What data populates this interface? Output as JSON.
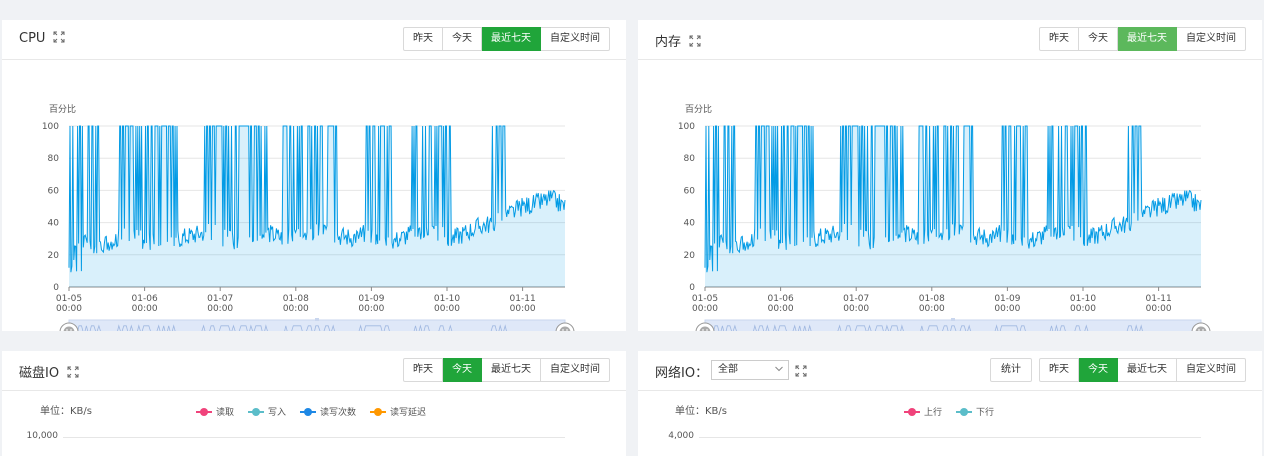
{
  "time_buttons": [
    "昨天",
    "今天",
    "最近七天",
    "自定义时间"
  ],
  "cpu": {
    "title": "CPU",
    "active": "最近七天",
    "ylabel": "百分比"
  },
  "memory": {
    "title": "内存",
    "active": "最近七天",
    "ylabel": "百分比"
  },
  "disk": {
    "title": "磁盘IO",
    "active": "今天",
    "unit": "单位：KB/s",
    "first_tick": "10,000",
    "legend": [
      "读取",
      "写入",
      "读写次数",
      "读写延迟"
    ],
    "legend_colors": [
      "#f0437b",
      "#5bbdc9",
      "#1e88e5",
      "#ff9800"
    ]
  },
  "network": {
    "title": "网络IO：",
    "select_value": "全部",
    "stats_button": "统计",
    "active": "今天",
    "unit": "单位：KB/s",
    "first_tick": "4,000",
    "legend": [
      "上行",
      "下行"
    ],
    "legend_colors": [
      "#f0437b",
      "#5bbdc9"
    ]
  },
  "colors": {
    "series": "#039be5",
    "accent": "#20a53a"
  },
  "chart_data": [
    {
      "type": "area",
      "chart": "CPU",
      "ylabel": "百分比",
      "ylim": [
        0,
        100
      ],
      "yticks": [
        0,
        20,
        40,
        60,
        80,
        100
      ],
      "xticks": [
        "01-05\n00:00",
        "01-06\n00:00",
        "01-07\n00:00",
        "01-08\n00:00",
        "01-09\n00:00",
        "01-10\n00:00",
        "01-11\n00:00"
      ],
      "series": [
        {
          "values": [
            30,
            28,
            26,
            29,
            32,
            30,
            27,
            28,
            31,
            33,
            35,
            30,
            29,
            32,
            34,
            31,
            30,
            33,
            36,
            32,
            31,
            34,
            30,
            29,
            33,
            35,
            32,
            30,
            34,
            38,
            40,
            45,
            50,
            52,
            55,
            50
          ]
        }
      ],
      "spike_segments": [
        [
          0.0,
          0.07
        ],
        [
          0.1,
          0.22
        ],
        [
          0.27,
          0.4
        ],
        [
          0.43,
          0.54
        ],
        [
          0.58,
          0.65
        ],
        [
          0.69,
          0.77
        ],
        [
          0.85,
          0.88
        ]
      ],
      "grid": true,
      "datazoom": true
    },
    {
      "type": "area",
      "chart": "内存",
      "ylabel": "百分比",
      "ylim": [
        0,
        100
      ],
      "yticks": [
        0,
        20,
        40,
        60,
        80,
        100
      ],
      "xticks": [
        "01-05\n00:00",
        "01-06\n00:00",
        "01-07\n00:00",
        "01-08\n00:00",
        "01-09\n00:00",
        "01-10\n00:00",
        "01-11\n00:00"
      ],
      "series": [
        {
          "values": [
            30,
            28,
            26,
            29,
            32,
            30,
            27,
            28,
            31,
            33,
            35,
            30,
            29,
            32,
            34,
            31,
            30,
            33,
            36,
            32,
            31,
            34,
            30,
            29,
            33,
            35,
            32,
            30,
            34,
            38,
            40,
            45,
            50,
            52,
            55,
            50
          ]
        }
      ],
      "spike_segments": [
        [
          0.0,
          0.07
        ],
        [
          0.1,
          0.22
        ],
        [
          0.27,
          0.4
        ],
        [
          0.43,
          0.54
        ],
        [
          0.58,
          0.65
        ],
        [
          0.69,
          0.77
        ],
        [
          0.85,
          0.88
        ]
      ],
      "grid": true,
      "datazoom": true
    }
  ]
}
